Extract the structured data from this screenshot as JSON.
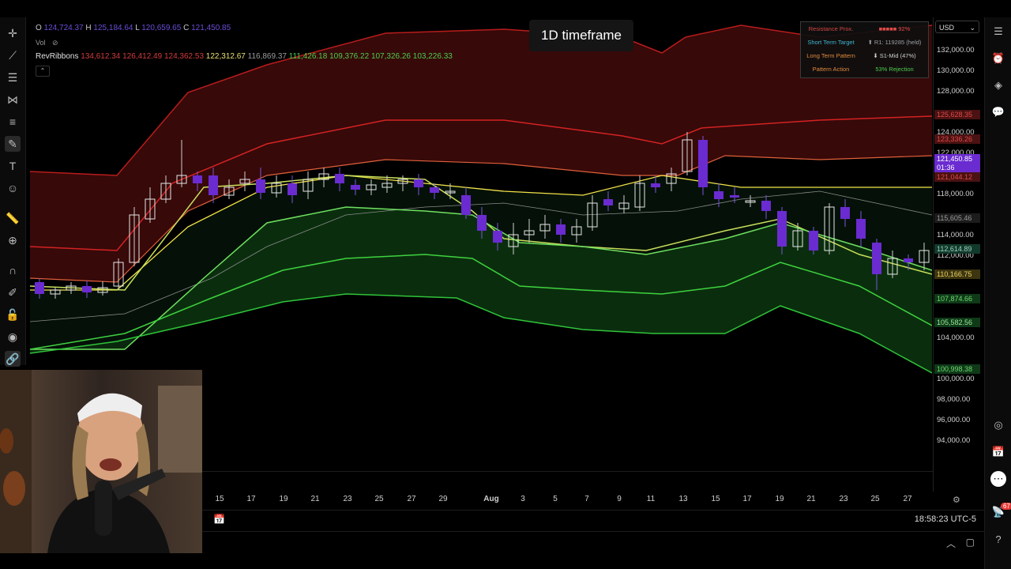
{
  "ohlc": {
    "o_label": "O",
    "o": "124,724.37",
    "h_label": "H",
    "h": "125,184.64",
    "l_label": "L",
    "l": "120,659.65",
    "c_label": "C",
    "c": "121,450.85"
  },
  "vol_label": "Vol",
  "indicator": {
    "name": "RevRibbons",
    "red_values": [
      "134,612.34",
      "126,412.49",
      "124,362.53"
    ],
    "mid_values": [
      "122,312.67",
      "116,869.37"
    ],
    "green_values": [
      "111,426.18",
      "109,376.22",
      "107,326.26",
      "103,226.33"
    ]
  },
  "tooltip": "1D timeframe",
  "currency": "USD",
  "table": [
    {
      "key": "Resistance Prox.",
      "value": "■■■■■ 92%",
      "kc": "#d64545",
      "vc": "#e24a4a"
    },
    {
      "key": "Short Term Target",
      "value": "⬆ R1: 119285 (held)",
      "kc": "#3fb6d0",
      "vc": "#9aa0a6"
    },
    {
      "key": "Long Term Pattern",
      "value": "⬇ S1-Mid (47%)",
      "kc": "#e08a3c",
      "vc": "#cfcfcf"
    },
    {
      "key": "Pattern Action",
      "value": "53% Rejection",
      "kc": "#e08a3c",
      "vc": "#4ccd4c"
    }
  ],
  "price_levels": [
    "132,000.00",
    "130,000.00",
    "128,000.00",
    "124,000.00",
    "122,000.00",
    "118,000.00",
    "114,000.00",
    "112,000.00",
    "104,000.00",
    "100,000.00",
    "98,000.00",
    "96,000.00",
    "94,000.00"
  ],
  "price_tags": [
    {
      "v": "125,628.35",
      "bg": "#4a1212",
      "fg": "#e04848"
    },
    {
      "v": "123,336.26",
      "bg": "#4a1212",
      "fg": "#e04848"
    },
    {
      "v": "121,450.85",
      "bg": "#6a2bd0",
      "fg": "#ffffff"
    },
    {
      "v": "01:36",
      "bg": "#6a2bd0",
      "fg": "#ffffff"
    },
    {
      "v": "121,044.12",
      "bg": "#4a1212",
      "fg": "#e04848"
    },
    {
      "v": "115,605.46",
      "bg": "#1c1c1c",
      "fg": "#9a9a9a"
    },
    {
      "v": "112,614.89",
      "bg": "#123a2a",
      "fg": "#9ad0c0"
    },
    {
      "v": "110,166.75",
      "bg": "#3d3510",
      "fg": "#e8d060"
    },
    {
      "v": "107,874.66",
      "bg": "#0f3a18",
      "fg": "#6fd86f"
    },
    {
      "v": "105,582.56",
      "bg": "#0f3a18",
      "fg": "#9aeb9a"
    },
    {
      "v": "100,998.38",
      "bg": "#0f3a18",
      "fg": "#6fd86f"
    }
  ],
  "time_labels": [
    "15",
    "17",
    "19",
    "21",
    "23",
    "25",
    "27",
    "29",
    "Aug",
    "3",
    "5",
    "7",
    "9",
    "11",
    "13",
    "15",
    "17",
    "19",
    "21",
    "23",
    "25",
    "27"
  ],
  "clock": "18:58:23 UTC-5",
  "notification_count": "67",
  "colors": {
    "bull": "#e8e8e8",
    "bear": "#6a2bd0",
    "red_band": "#d22a2a",
    "green_band": "#2fcb3a",
    "yellow": "#f2e34a"
  }
}
